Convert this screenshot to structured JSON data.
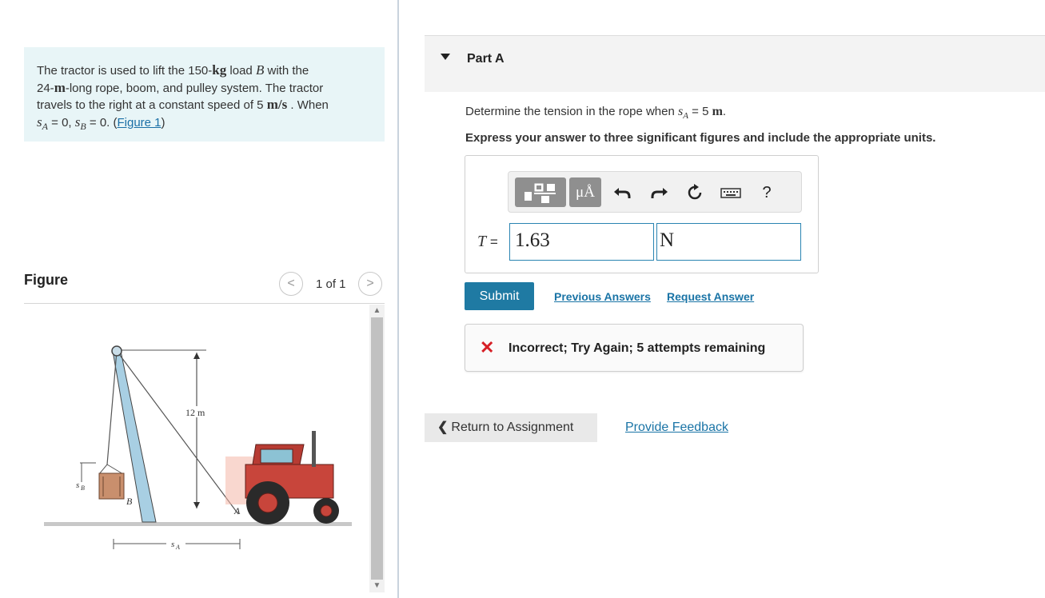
{
  "problem": {
    "p1": "The tractor is used to lift the 150-",
    "kg": "kg",
    "p2": " load ",
    "B": "B",
    "p3": " with the",
    "p4": "24-",
    "m": "m",
    "p5": "-long rope, boom, and pulley system. The tractor",
    "p6": "travels to the right at a constant speed of 5 ",
    "ms": "m/s",
    "p7": " . When",
    "sA": "s",
    "sA_sub": "A",
    "p8": " = 0, ",
    "sB": "s",
    "sB_sub": "B",
    "p9": " = 0. (",
    "figure_link": "Figure 1",
    "p10": ")"
  },
  "figure": {
    "title": "Figure",
    "pager": "1 of 1",
    "prev": "<",
    "next": ">",
    "label_12m": "12 m",
    "label_sB": "s",
    "label_sB_sub": "B",
    "label_B": "B",
    "label_A": "A",
    "label_sA": "s",
    "label_sA_sub": "A"
  },
  "part": {
    "title": "Part A",
    "question_pre": "Determine the tension in the rope when ",
    "question_s": "s",
    "question_sub": "A",
    "question_post": " = 5 ",
    "question_unit": "m",
    "question_end": ".",
    "instruction": "Express your answer to three significant figures and include the appropriate units."
  },
  "toolbar": {
    "units_label": "μÅ",
    "help": "?"
  },
  "answer": {
    "variable": "T",
    "equals": " = ",
    "value": "1.63",
    "unit": "N"
  },
  "actions": {
    "submit": "Submit",
    "previous_answers": "Previous Answers",
    "request_answer": "Request Answer"
  },
  "feedback": {
    "icon": "✕",
    "text": "Incorrect; Try Again; 5 attempts remaining"
  },
  "footer": {
    "return": "Return to Assignment",
    "return_chev": "❮",
    "provide_feedback": "Provide Feedback"
  },
  "colors": {
    "accent": "#1f7aa3",
    "link": "#1a74a6",
    "error": "#d61f26",
    "problem_bg": "#e8f5f7"
  }
}
